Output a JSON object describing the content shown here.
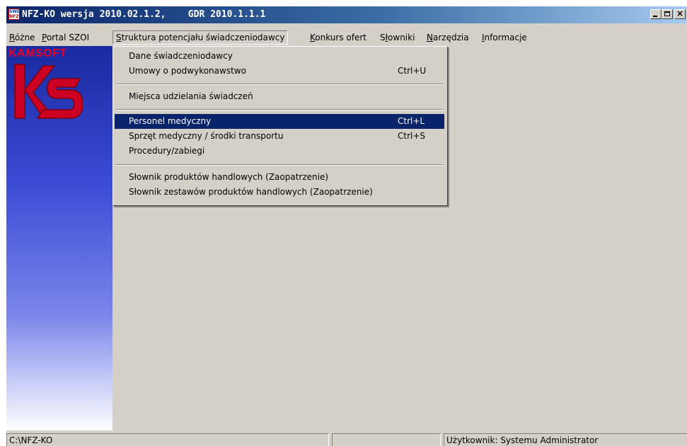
{
  "window": {
    "title": "NFZ-KO wersja 2010.02.1.2,    GDR 2010.1.1.1",
    "icon": "app-icon",
    "buttons": {
      "minimize": "_",
      "maximize": "□",
      "close": "×"
    }
  },
  "menubar": {
    "items": [
      {
        "label": "Różne",
        "mnemonic": "R"
      },
      {
        "label": "Portal SZOI",
        "mnemonic": "P"
      },
      {
        "label": "Struktura potencjału świadczeniodawcy",
        "mnemonic": "S",
        "active": true
      },
      {
        "label": "Konkurs ofert",
        "mnemonic": "K"
      },
      {
        "label": "Słowniki",
        "mnemonic": "o"
      },
      {
        "label": "Narzędzia",
        "mnemonic": "N"
      },
      {
        "label": "Informacje",
        "mnemonic": "I"
      }
    ]
  },
  "sidebar": {
    "brand": "KAMSOFT",
    "logo_colors": {
      "brand": "#e8002a",
      "logo": "#cc0022"
    }
  },
  "dropdown": {
    "items": [
      {
        "label": "Dane świadczeniodawcy",
        "shortcut": ""
      },
      {
        "label": "Umowy o podwykonawstwo",
        "shortcut": "Ctrl+U"
      },
      {
        "label": "Miejsca udzielania świadczeń",
        "shortcut": ""
      },
      {
        "label": "Personel medyczny",
        "shortcut": "Ctrl+L",
        "selected": true
      },
      {
        "label": "Sprzęt medyczny / środki transportu",
        "shortcut": "Ctrl+S"
      },
      {
        "label": "Procedury/zabiegi",
        "shortcut": ""
      },
      {
        "label": "Słownik produktów handlowych (Zaopatrzenie)",
        "shortcut": ""
      },
      {
        "label": "Słownik zestawów produktów handlowych (Zaopatrzenie)",
        "shortcut": ""
      }
    ]
  },
  "statusbar": {
    "path": "C:\\NFZ-KO",
    "middle": "",
    "user": "Użytkownik:  Systemu Administrator"
  },
  "colors": {
    "face": "#d4d0c8",
    "title_active": "#0a246a",
    "selection": "#0a246a"
  }
}
